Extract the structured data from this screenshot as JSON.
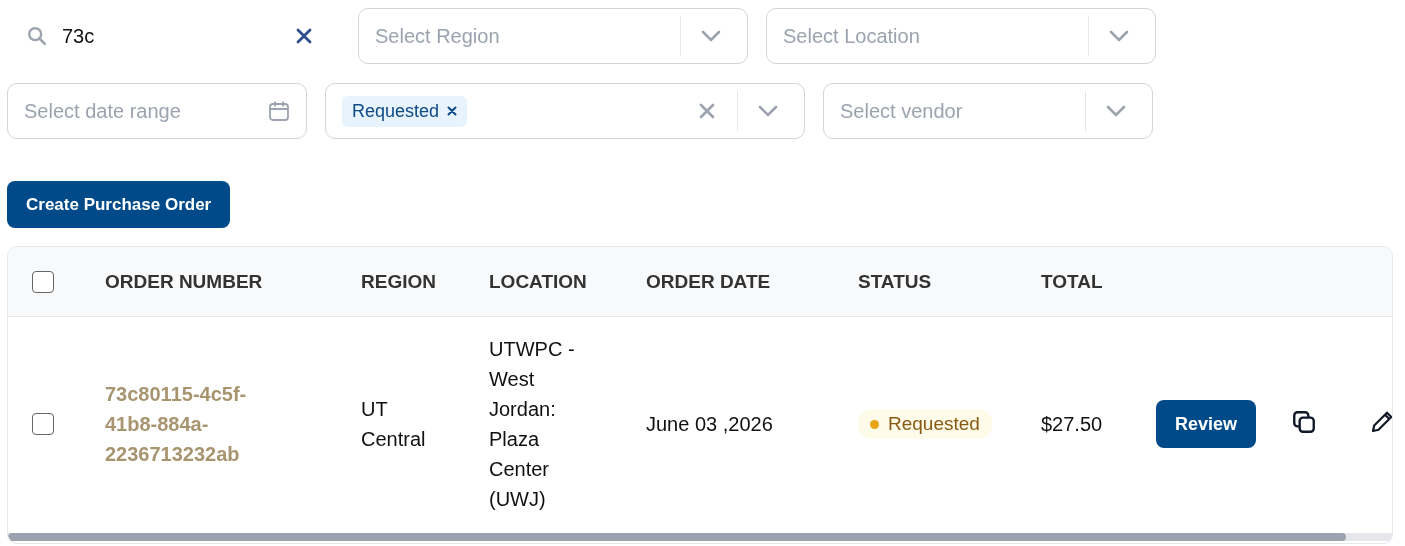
{
  "search": {
    "value": "73c"
  },
  "filters": [
    {
      "kind": "select",
      "placeholder": "Select Region"
    },
    {
      "kind": "select",
      "placeholder": "Select Location"
    },
    {
      "kind": "date",
      "placeholder": "Select date range"
    },
    {
      "kind": "multi",
      "tags": [
        "Requested"
      ]
    },
    {
      "kind": "select",
      "placeholder": "Select vendor"
    }
  ],
  "create_button": "Create Purchase Order",
  "table": {
    "select_all": {
      "checked": false
    },
    "columns": [
      "ORDER NUMBER",
      "REGION",
      "LOCATION",
      "ORDER DATE",
      "STATUS",
      "TOTAL"
    ],
    "rows": [
      {
        "checked": false,
        "order_number": "73c80115-4c5f-41b8-884a-2236713232ab",
        "region": "UT Central",
        "location": "UTWPC - West Jordan: Plaza Center (UWJ)",
        "order_date": "June 03 ,2026",
        "status": {
          "kind": "requested",
          "label": "Requested"
        },
        "total": "$27.50",
        "action": "Review"
      }
    ]
  }
}
